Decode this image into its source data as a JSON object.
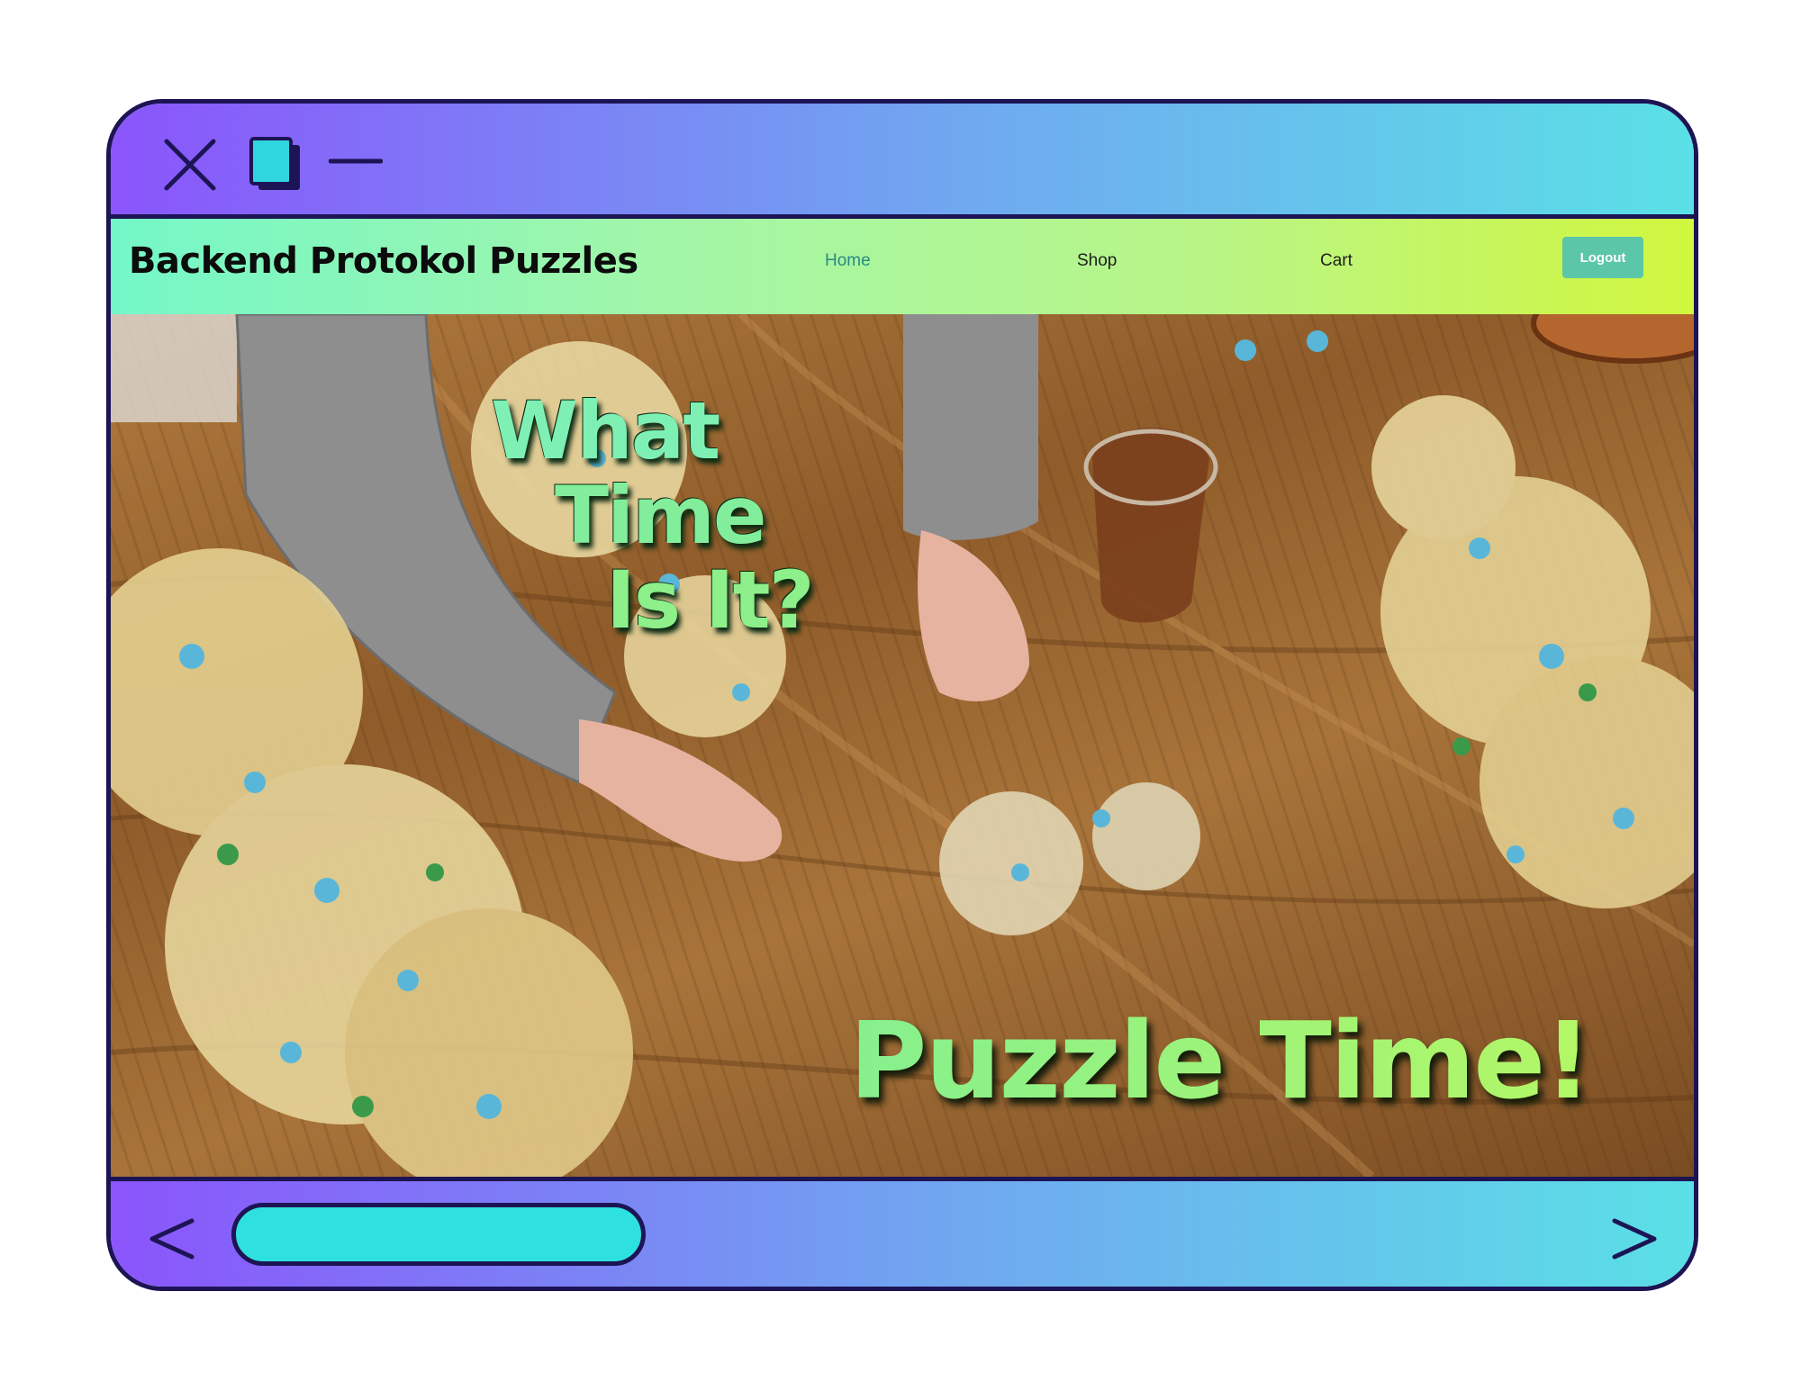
{
  "window": {
    "controls": {
      "close_icon": "close-icon",
      "restore_icon": "restore-icon",
      "minimize_icon": "minimize-icon"
    },
    "colors": {
      "frame": "#1c1454",
      "bar_gradient_start": "#8a55fb",
      "bar_gradient_end": "#5ae0e6",
      "restore_fill": "#2fd6e0"
    }
  },
  "navbar": {
    "brand": "Backend Protokol Puzzles",
    "links": [
      {
        "label": "Home",
        "active": true
      },
      {
        "label": "Shop",
        "active": false
      },
      {
        "label": "Cart",
        "active": false
      }
    ],
    "logout_label": "Logout",
    "colors": {
      "gradient_start": "#74f7c8",
      "gradient_end": "#d1f73e",
      "active_link": "#2a8a82",
      "logout_bg": "#5cc6a8"
    }
  },
  "hero": {
    "headline_lines": [
      "What",
      "Time",
      "Is It?"
    ],
    "tagline": "Puzzle Time!",
    "colors": {
      "headline": "#82ee9c",
      "tagline": "#9cf27a"
    }
  },
  "bottombar": {
    "back_icon": "chevron-left-icon",
    "forward_icon": "chevron-right-icon",
    "address_pill_color": "#2fe0e0"
  }
}
